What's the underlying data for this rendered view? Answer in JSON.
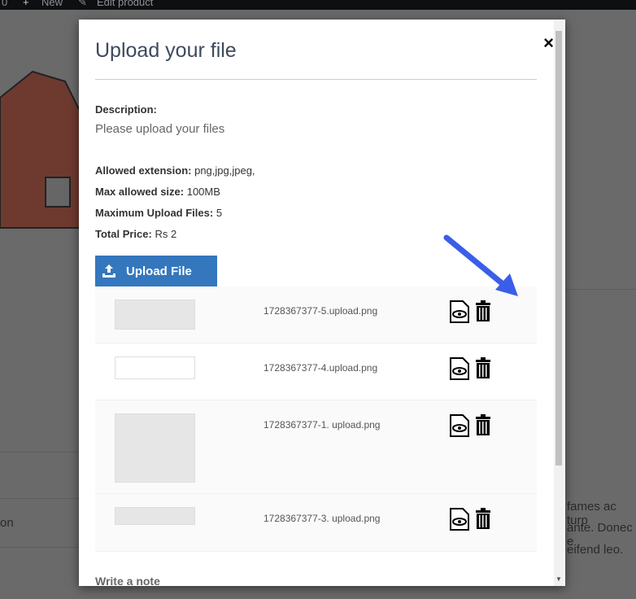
{
  "adminbar": {
    "count": "0",
    "new_label": "New",
    "edit_label": "Edit product"
  },
  "background": {
    "line1": "fames ac turp",
    "line2": "ante. Donec e",
    "line3": "eifend leo.",
    "side_text": "on"
  },
  "modal": {
    "title": "Upload your file",
    "description_label": "Description:",
    "description": "Please upload your files",
    "allowed_ext_label": "Allowed extension:",
    "allowed_ext": "png,jpg,jpeg,",
    "max_size_label": "Max allowed size:",
    "max_size": "100MB",
    "max_files_label": "Maximum Upload Files:",
    "max_files": "5",
    "price_label": "Total Price:",
    "price": "Rs 2",
    "upload_button": "Upload File",
    "files": [
      {
        "name": "1728367377-5.upload.png"
      },
      {
        "name": "1728367377-4.upload.png"
      },
      {
        "name": "1728367377-1. upload.png"
      },
      {
        "name": "1728367377-3. upload.png"
      }
    ],
    "note_label": "Write a note",
    "close": "×"
  },
  "colors": {
    "accent": "#3477bd",
    "arrow": "#3b5ee8"
  }
}
